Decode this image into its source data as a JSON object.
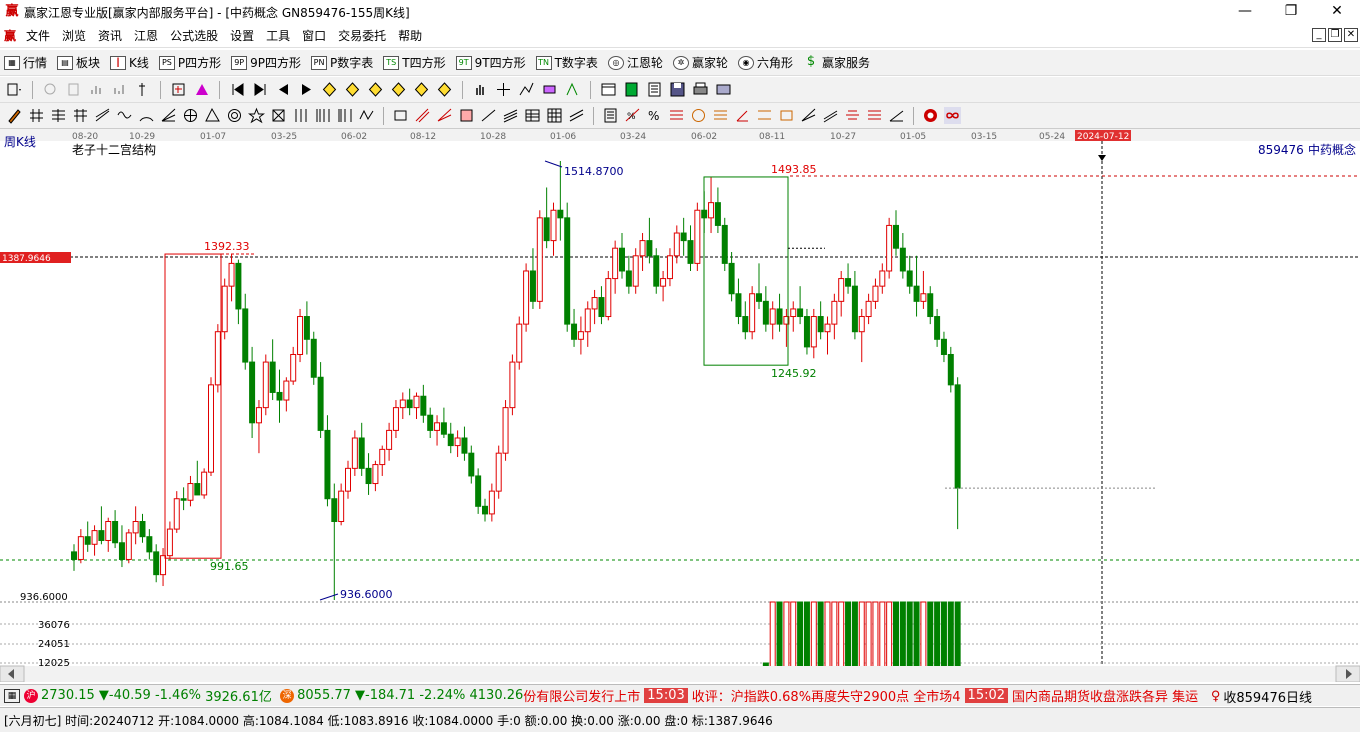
{
  "window": {
    "title": "赢家江恩专业版[赢家内部服务平台] - [中药概念  GN859476-155周K线]",
    "logo": "赢",
    "minimize": "—",
    "maximize": "❐",
    "close": "✕"
  },
  "menu": {
    "logo": "赢",
    "items": [
      "文件",
      "浏览",
      "资讯",
      "江恩",
      "公式选股",
      "设置",
      "工具",
      "窗口",
      "交易委托",
      "帮助"
    ]
  },
  "toolbar1": {
    "items": [
      {
        "icon": "grid-icon",
        "label": "行情"
      },
      {
        "icon": "blocks-icon",
        "label": "板块"
      },
      {
        "icon": "candles-icon",
        "label": "K线"
      },
      {
        "icon": "ps-icon",
        "label": "P四方形",
        "badge": "PS"
      },
      {
        "icon": "9p-icon",
        "label": "9P四方形",
        "badge": "9P"
      },
      {
        "icon": "pn-icon",
        "label": "P数字表",
        "badge": "PN"
      },
      {
        "icon": "ts-icon",
        "label": "T四方形",
        "badge": "TS"
      },
      {
        "icon": "9t-icon",
        "label": "9T四方形",
        "badge": "9T"
      },
      {
        "icon": "tn-icon",
        "label": "T数字表",
        "badge": "TN"
      },
      {
        "icon": "wheel-icon",
        "label": "江恩轮"
      },
      {
        "icon": "wheel2-icon",
        "label": "赢家轮"
      },
      {
        "icon": "hexagon-icon",
        "label": "六角形"
      },
      {
        "icon": "dollar-icon",
        "label": "赢家服务"
      }
    ]
  },
  "chart_header": {
    "period": "周K线",
    "indicator": "老子十二宫结构",
    "code": "859476",
    "name": "中药概念",
    "cursor_date": "2024-07-12",
    "cursor_price": "1387.9646"
  },
  "chart_data": {
    "type": "candlestick",
    "x_tick_labels": [
      "08-20",
      "10-29",
      "01-07",
      "03-25",
      "06-02",
      "08-12",
      "10-28",
      "01-06",
      "03-24",
      "06-02",
      "08-11",
      "10-27",
      "01-05",
      "03-15",
      "05-24"
    ],
    "annotations": {
      "high_label": "1514.8700",
      "low_label": "936.6000",
      "box1_top": "1392.33",
      "box1_bottom": "991.65",
      "box2_top": "1493.85",
      "box2_bottom": "1245.92",
      "y_low_tick": "936.6000"
    },
    "volume_ticks": [
      "36076",
      "24051",
      "12025"
    ],
    "candles": [
      [
        1000,
        1010,
        975,
        990
      ],
      [
        990,
        1030,
        985,
        1020
      ],
      [
        1020,
        1040,
        1000,
        1010
      ],
      [
        1010,
        1035,
        995,
        1028
      ],
      [
        1028,
        1060,
        1010,
        1015
      ],
      [
        1015,
        1045,
        1000,
        1040
      ],
      [
        1040,
        1055,
        1005,
        1012
      ],
      [
        1012,
        1035,
        980,
        990
      ],
      [
        990,
        1030,
        985,
        1025
      ],
      [
        1025,
        1060,
        1010,
        1040
      ],
      [
        1040,
        1050,
        1012,
        1020
      ],
      [
        1020,
        1030,
        990,
        1000
      ],
      [
        1000,
        1010,
        960,
        970
      ],
      [
        970,
        1005,
        955,
        995
      ],
      [
        995,
        1040,
        990,
        1030
      ],
      [
        1030,
        1080,
        1025,
        1070
      ],
      [
        1070,
        1085,
        1055,
        1068
      ],
      [
        1068,
        1100,
        1060,
        1090
      ],
      [
        1090,
        1120,
        1075,
        1075
      ],
      [
        1075,
        1110,
        1070,
        1105
      ],
      [
        1105,
        1230,
        1100,
        1220
      ],
      [
        1220,
        1300,
        1210,
        1290
      ],
      [
        1290,
        1360,
        1280,
        1350
      ],
      [
        1350,
        1392,
        1330,
        1380
      ],
      [
        1380,
        1385,
        1300,
        1320
      ],
      [
        1320,
        1340,
        1240,
        1250
      ],
      [
        1250,
        1270,
        1150,
        1170
      ],
      [
        1170,
        1200,
        1130,
        1190
      ],
      [
        1190,
        1260,
        1180,
        1250
      ],
      [
        1250,
        1280,
        1200,
        1210
      ],
      [
        1210,
        1240,
        1170,
        1200
      ],
      [
        1200,
        1230,
        1185,
        1225
      ],
      [
        1225,
        1270,
        1220,
        1260
      ],
      [
        1260,
        1320,
        1250,
        1310
      ],
      [
        1310,
        1330,
        1260,
        1280
      ],
      [
        1280,
        1290,
        1220,
        1230
      ],
      [
        1230,
        1250,
        1150,
        1160
      ],
      [
        1160,
        1180,
        1060,
        1070
      ],
      [
        1070,
        1090,
        936.6,
        1040
      ],
      [
        1040,
        1090,
        1035,
        1080
      ],
      [
        1080,
        1120,
        1070,
        1110
      ],
      [
        1110,
        1160,
        1100,
        1150
      ],
      [
        1150,
        1170,
        1100,
        1110
      ],
      [
        1110,
        1130,
        1075,
        1090
      ],
      [
        1090,
        1120,
        1080,
        1115
      ],
      [
        1115,
        1140,
        1100,
        1135
      ],
      [
        1135,
        1170,
        1120,
        1160
      ],
      [
        1160,
        1200,
        1150,
        1190
      ],
      [
        1190,
        1210,
        1175,
        1200
      ],
      [
        1200,
        1215,
        1180,
        1190
      ],
      [
        1190,
        1210,
        1175,
        1205
      ],
      [
        1205,
        1220,
        1170,
        1180
      ],
      [
        1180,
        1190,
        1150,
        1160
      ],
      [
        1160,
        1180,
        1140,
        1170
      ],
      [
        1170,
        1190,
        1150,
        1155
      ],
      [
        1155,
        1170,
        1130,
        1140
      ],
      [
        1140,
        1160,
        1125,
        1150
      ],
      [
        1150,
        1165,
        1120,
        1130
      ],
      [
        1130,
        1140,
        1090,
        1100
      ],
      [
        1100,
        1110,
        1050,
        1060
      ],
      [
        1060,
        1070,
        1040,
        1050
      ],
      [
        1050,
        1090,
        1040,
        1080
      ],
      [
        1080,
        1140,
        1070,
        1130
      ],
      [
        1130,
        1200,
        1120,
        1190
      ],
      [
        1190,
        1260,
        1180,
        1250
      ],
      [
        1250,
        1310,
        1240,
        1300
      ],
      [
        1300,
        1380,
        1290,
        1370
      ],
      [
        1370,
        1400,
        1320,
        1330
      ],
      [
        1330,
        1450,
        1320,
        1440
      ],
      [
        1440,
        1480,
        1400,
        1410
      ],
      [
        1410,
        1460,
        1390,
        1450
      ],
      [
        1450,
        1514.87,
        1410,
        1440
      ],
      [
        1440,
        1460,
        1290,
        1300
      ],
      [
        1300,
        1320,
        1270,
        1280
      ],
      [
        1280,
        1310,
        1260,
        1290
      ],
      [
        1290,
        1330,
        1270,
        1320
      ],
      [
        1320,
        1345,
        1300,
        1335
      ],
      [
        1335,
        1350,
        1300,
        1310
      ],
      [
        1310,
        1370,
        1305,
        1360
      ],
      [
        1360,
        1410,
        1340,
        1400
      ],
      [
        1400,
        1420,
        1360,
        1370
      ],
      [
        1370,
        1390,
        1340,
        1350
      ],
      [
        1350,
        1400,
        1340,
        1390
      ],
      [
        1390,
        1420,
        1370,
        1410
      ],
      [
        1410,
        1440,
        1380,
        1390
      ],
      [
        1390,
        1400,
        1340,
        1350
      ],
      [
        1350,
        1370,
        1330,
        1360
      ],
      [
        1360,
        1400,
        1350,
        1390
      ],
      [
        1390,
        1430,
        1380,
        1420
      ],
      [
        1420,
        1440,
        1390,
        1410
      ],
      [
        1410,
        1430,
        1370,
        1380
      ],
      [
        1380,
        1460,
        1370,
        1450
      ],
      [
        1450,
        1475,
        1420,
        1440
      ],
      [
        1440,
        1493.85,
        1420,
        1460
      ],
      [
        1460,
        1480,
        1420,
        1430
      ],
      [
        1430,
        1440,
        1370,
        1380
      ],
      [
        1380,
        1395,
        1330,
        1340
      ],
      [
        1340,
        1360,
        1300,
        1310
      ],
      [
        1310,
        1330,
        1280,
        1290
      ],
      [
        1290,
        1350,
        1280,
        1340
      ],
      [
        1340,
        1380,
        1320,
        1330
      ],
      [
        1330,
        1350,
        1290,
        1300
      ],
      [
        1300,
        1330,
        1280,
        1320
      ],
      [
        1320,
        1340,
        1290,
        1300
      ],
      [
        1300,
        1320,
        1270,
        1310
      ],
      [
        1310,
        1330,
        1290,
        1320
      ],
      [
        1320,
        1350,
        1300,
        1310
      ],
      [
        1310,
        1320,
        1260,
        1270
      ],
      [
        1270,
        1320,
        1255,
        1310
      ],
      [
        1310,
        1330,
        1280,
        1290
      ],
      [
        1290,
        1310,
        1260,
        1300
      ],
      [
        1300,
        1340,
        1280,
        1330
      ],
      [
        1330,
        1370,
        1310,
        1360
      ],
      [
        1360,
        1380,
        1340,
        1350
      ],
      [
        1350,
        1370,
        1280,
        1290
      ],
      [
        1290,
        1320,
        1250,
        1310
      ],
      [
        1310,
        1340,
        1300,
        1330
      ],
      [
        1330,
        1360,
        1320,
        1350
      ],
      [
        1350,
        1380,
        1340,
        1370
      ],
      [
        1370,
        1440,
        1360,
        1430
      ],
      [
        1430,
        1450,
        1390,
        1400
      ],
      [
        1400,
        1420,
        1360,
        1370
      ],
      [
        1370,
        1390,
        1340,
        1350
      ],
      [
        1350,
        1390,
        1310,
        1330
      ],
      [
        1330,
        1370,
        1320,
        1340
      ],
      [
        1340,
        1350,
        1300,
        1310
      ],
      [
        1310,
        1320,
        1270,
        1280
      ],
      [
        1280,
        1290,
        1250,
        1260
      ],
      [
        1260,
        1270,
        1210,
        1220
      ],
      [
        1220,
        1230,
        1030,
        1084
      ]
    ]
  },
  "status_ticker": {
    "index1_value": "2730.15",
    "index1_change": "▼-40.59",
    "index1_pct": "-1.46%",
    "index1_amount": "3926.61亿",
    "index2_value": "8055.77",
    "index2_change": "▼-184.71",
    "index2_pct": "-2.24%",
    "index2_amount": "4130.26",
    "news1": "份有限公司发行上市",
    "time1": "15:03",
    "news2": "收评：沪指跌0.68%再度失守2900点 全市场4",
    "time2": "15:02",
    "news3": "国内商品期货收盘涨跌各异 集运",
    "right_label": "收859476日线"
  },
  "info_bar": {
    "text": "[六月初七] 时间:20240712 开:1084.0000 高:1084.1084 低:1083.8916 收:1084.0000 手:0 额:0.00 换:0.00 涨:0.00 盘:0 标:1387.9646"
  }
}
